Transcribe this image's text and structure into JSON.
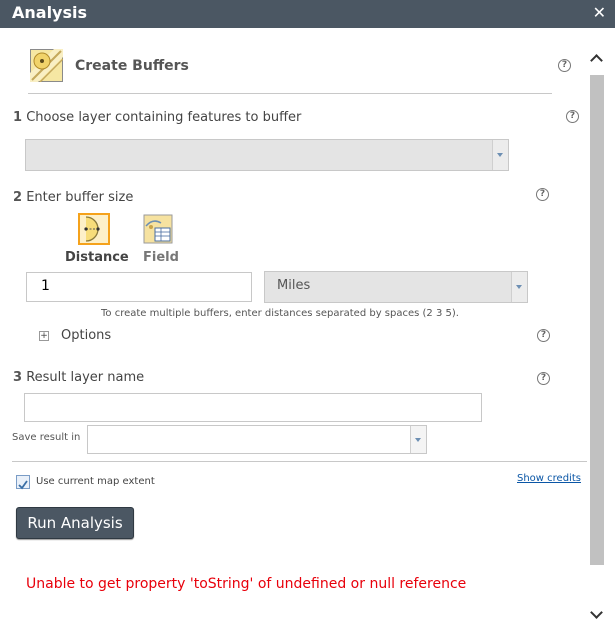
{
  "window": {
    "title": "Analysis",
    "close_glyph": "✕"
  },
  "tool": {
    "title": "Create Buffers",
    "icon": "create-buffers-icon",
    "help_glyph": "?"
  },
  "step1": {
    "number": "1",
    "label": "Choose layer containing features to buffer",
    "selected": ""
  },
  "step2": {
    "number": "2",
    "label": "Enter buffer size",
    "modes": [
      {
        "label": "Distance",
        "icon": "distance-icon",
        "selected": true
      },
      {
        "label": "Field",
        "icon": "field-icon",
        "selected": false
      }
    ],
    "distance_value": "1",
    "unit": "Miles",
    "hint": "To create multiple buffers, enter distances separated by spaces (2 3 5).",
    "options_label": "Options",
    "options_expander": "+"
  },
  "step3": {
    "number": "3",
    "label": "Result layer name",
    "value": "",
    "save_label": "Save result in",
    "save_value": ""
  },
  "extent": {
    "label": "Use current map extent",
    "checked": true
  },
  "show_credits": "Show credits",
  "run_button": "Run Analysis",
  "error": "Unable to get property 'toString' of undefined or null reference",
  "colors": {
    "header_bg": "#4b5763",
    "error": "#e8000b",
    "link": "#0a56a6",
    "selected_border": "#f5a21b"
  }
}
